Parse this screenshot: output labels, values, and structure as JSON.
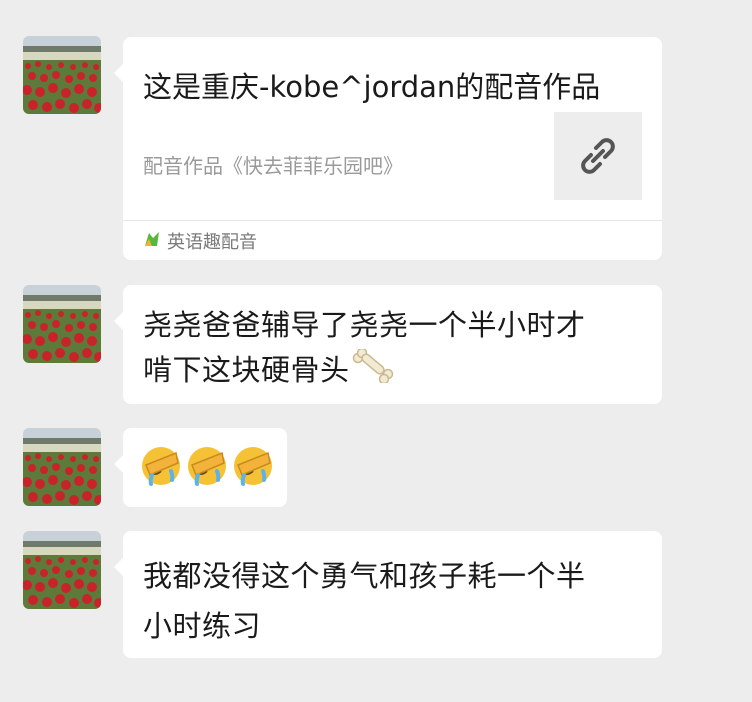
{
  "messages": [
    {
      "type": "link_card",
      "title": "这是重庆-kobe^jordan的配音作品",
      "subtitle": "配音作品《快去菲菲乐园吧》",
      "source": "英语趣配音",
      "thumb_icon": "link-icon",
      "source_icon": "app-logo-icon"
    },
    {
      "type": "text",
      "lines": [
        "尧尧爸爸辅导了尧尧一个半小时才",
        "啃下这块硬骨头"
      ],
      "trailing_icon": "bone-icon"
    },
    {
      "type": "emoji",
      "emojis": [
        "face-palm-crying-icon",
        "face-palm-crying-icon",
        "face-palm-crying-icon"
      ]
    },
    {
      "type": "text",
      "lines": [
        "我都没得这个勇气和孩子耗一个半",
        "小时练习"
      ]
    }
  ],
  "colors": {
    "background": "#ededed",
    "bubble": "#ffffff",
    "avatar_flowers": "#c8232b"
  }
}
